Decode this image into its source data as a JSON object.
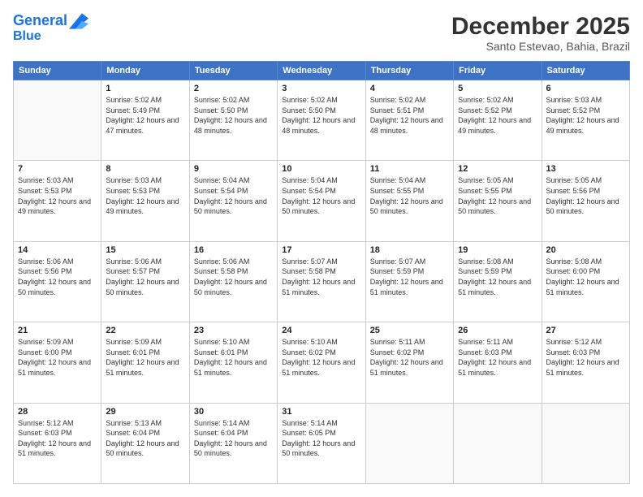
{
  "header": {
    "logo_line1": "General",
    "logo_line2": "Blue",
    "title": "December 2025",
    "subtitle": "Santo Estevao, Bahia, Brazil"
  },
  "days_of_week": [
    "Sunday",
    "Monday",
    "Tuesday",
    "Wednesday",
    "Thursday",
    "Friday",
    "Saturday"
  ],
  "weeks": [
    [
      {
        "day": "",
        "sunrise": "",
        "sunset": "",
        "daylight": ""
      },
      {
        "day": "1",
        "sunrise": "Sunrise: 5:02 AM",
        "sunset": "Sunset: 5:49 PM",
        "daylight": "Daylight: 12 hours and 47 minutes."
      },
      {
        "day": "2",
        "sunrise": "Sunrise: 5:02 AM",
        "sunset": "Sunset: 5:50 PM",
        "daylight": "Daylight: 12 hours and 48 minutes."
      },
      {
        "day": "3",
        "sunrise": "Sunrise: 5:02 AM",
        "sunset": "Sunset: 5:50 PM",
        "daylight": "Daylight: 12 hours and 48 minutes."
      },
      {
        "day": "4",
        "sunrise": "Sunrise: 5:02 AM",
        "sunset": "Sunset: 5:51 PM",
        "daylight": "Daylight: 12 hours and 48 minutes."
      },
      {
        "day": "5",
        "sunrise": "Sunrise: 5:02 AM",
        "sunset": "Sunset: 5:52 PM",
        "daylight": "Daylight: 12 hours and 49 minutes."
      },
      {
        "day": "6",
        "sunrise": "Sunrise: 5:03 AM",
        "sunset": "Sunset: 5:52 PM",
        "daylight": "Daylight: 12 hours and 49 minutes."
      }
    ],
    [
      {
        "day": "7",
        "sunrise": "Sunrise: 5:03 AM",
        "sunset": "Sunset: 5:53 PM",
        "daylight": "Daylight: 12 hours and 49 minutes."
      },
      {
        "day": "8",
        "sunrise": "Sunrise: 5:03 AM",
        "sunset": "Sunset: 5:53 PM",
        "daylight": "Daylight: 12 hours and 49 minutes."
      },
      {
        "day": "9",
        "sunrise": "Sunrise: 5:04 AM",
        "sunset": "Sunset: 5:54 PM",
        "daylight": "Daylight: 12 hours and 50 minutes."
      },
      {
        "day": "10",
        "sunrise": "Sunrise: 5:04 AM",
        "sunset": "Sunset: 5:54 PM",
        "daylight": "Daylight: 12 hours and 50 minutes."
      },
      {
        "day": "11",
        "sunrise": "Sunrise: 5:04 AM",
        "sunset": "Sunset: 5:55 PM",
        "daylight": "Daylight: 12 hours and 50 minutes."
      },
      {
        "day": "12",
        "sunrise": "Sunrise: 5:05 AM",
        "sunset": "Sunset: 5:55 PM",
        "daylight": "Daylight: 12 hours and 50 minutes."
      },
      {
        "day": "13",
        "sunrise": "Sunrise: 5:05 AM",
        "sunset": "Sunset: 5:56 PM",
        "daylight": "Daylight: 12 hours and 50 minutes."
      }
    ],
    [
      {
        "day": "14",
        "sunrise": "Sunrise: 5:06 AM",
        "sunset": "Sunset: 5:56 PM",
        "daylight": "Daylight: 12 hours and 50 minutes."
      },
      {
        "day": "15",
        "sunrise": "Sunrise: 5:06 AM",
        "sunset": "Sunset: 5:57 PM",
        "daylight": "Daylight: 12 hours and 50 minutes."
      },
      {
        "day": "16",
        "sunrise": "Sunrise: 5:06 AM",
        "sunset": "Sunset: 5:58 PM",
        "daylight": "Daylight: 12 hours and 50 minutes."
      },
      {
        "day": "17",
        "sunrise": "Sunrise: 5:07 AM",
        "sunset": "Sunset: 5:58 PM",
        "daylight": "Daylight: 12 hours and 51 minutes."
      },
      {
        "day": "18",
        "sunrise": "Sunrise: 5:07 AM",
        "sunset": "Sunset: 5:59 PM",
        "daylight": "Daylight: 12 hours and 51 minutes."
      },
      {
        "day": "19",
        "sunrise": "Sunrise: 5:08 AM",
        "sunset": "Sunset: 5:59 PM",
        "daylight": "Daylight: 12 hours and 51 minutes."
      },
      {
        "day": "20",
        "sunrise": "Sunrise: 5:08 AM",
        "sunset": "Sunset: 6:00 PM",
        "daylight": "Daylight: 12 hours and 51 minutes."
      }
    ],
    [
      {
        "day": "21",
        "sunrise": "Sunrise: 5:09 AM",
        "sunset": "Sunset: 6:00 PM",
        "daylight": "Daylight: 12 hours and 51 minutes."
      },
      {
        "day": "22",
        "sunrise": "Sunrise: 5:09 AM",
        "sunset": "Sunset: 6:01 PM",
        "daylight": "Daylight: 12 hours and 51 minutes."
      },
      {
        "day": "23",
        "sunrise": "Sunrise: 5:10 AM",
        "sunset": "Sunset: 6:01 PM",
        "daylight": "Daylight: 12 hours and 51 minutes."
      },
      {
        "day": "24",
        "sunrise": "Sunrise: 5:10 AM",
        "sunset": "Sunset: 6:02 PM",
        "daylight": "Daylight: 12 hours and 51 minutes."
      },
      {
        "day": "25",
        "sunrise": "Sunrise: 5:11 AM",
        "sunset": "Sunset: 6:02 PM",
        "daylight": "Daylight: 12 hours and 51 minutes."
      },
      {
        "day": "26",
        "sunrise": "Sunrise: 5:11 AM",
        "sunset": "Sunset: 6:03 PM",
        "daylight": "Daylight: 12 hours and 51 minutes."
      },
      {
        "day": "27",
        "sunrise": "Sunrise: 5:12 AM",
        "sunset": "Sunset: 6:03 PM",
        "daylight": "Daylight: 12 hours and 51 minutes."
      }
    ],
    [
      {
        "day": "28",
        "sunrise": "Sunrise: 5:12 AM",
        "sunset": "Sunset: 6:03 PM",
        "daylight": "Daylight: 12 hours and 51 minutes."
      },
      {
        "day": "29",
        "sunrise": "Sunrise: 5:13 AM",
        "sunset": "Sunset: 6:04 PM",
        "daylight": "Daylight: 12 hours and 50 minutes."
      },
      {
        "day": "30",
        "sunrise": "Sunrise: 5:14 AM",
        "sunset": "Sunset: 6:04 PM",
        "daylight": "Daylight: 12 hours and 50 minutes."
      },
      {
        "day": "31",
        "sunrise": "Sunrise: 5:14 AM",
        "sunset": "Sunset: 6:05 PM",
        "daylight": "Daylight: 12 hours and 50 minutes."
      },
      {
        "day": "",
        "sunrise": "",
        "sunset": "",
        "daylight": ""
      },
      {
        "day": "",
        "sunrise": "",
        "sunset": "",
        "daylight": ""
      },
      {
        "day": "",
        "sunrise": "",
        "sunset": "",
        "daylight": ""
      }
    ]
  ]
}
